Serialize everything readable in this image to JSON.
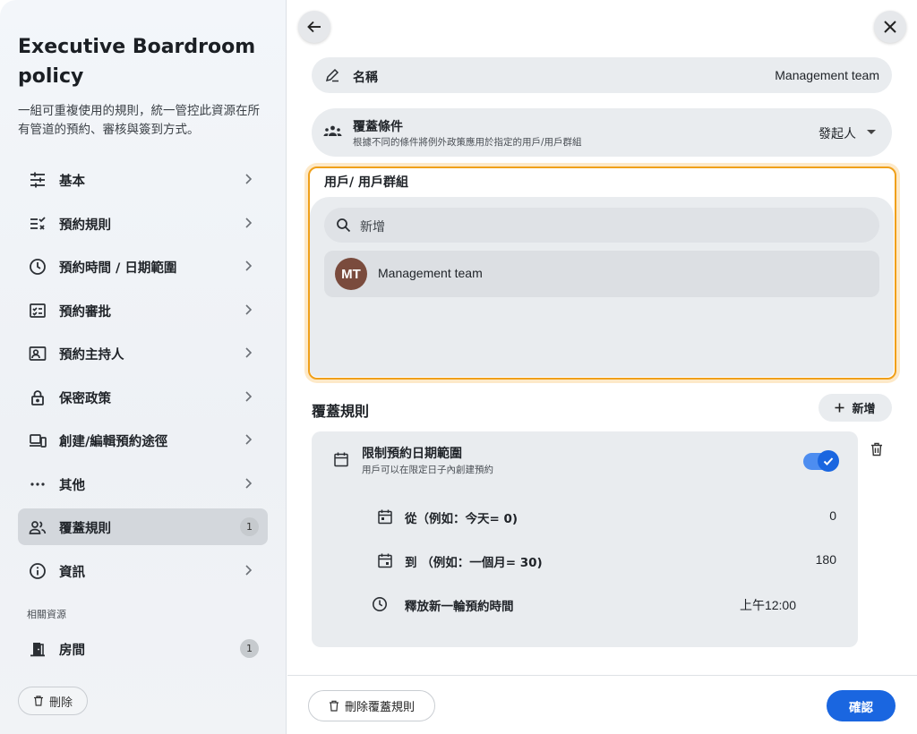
{
  "sidebar": {
    "title": "Executive Boardroom policy",
    "description": "一組可重複使用的規則，統一管控此資源在所有管道的預約、審核與簽到方式。",
    "items": [
      {
        "label": "基本",
        "icon": "tune-icon"
      },
      {
        "label": "預約規則",
        "icon": "checklist-icon"
      },
      {
        "label": "預約時間 / 日期範圍",
        "icon": "clock-icon"
      },
      {
        "label": "預約審批",
        "icon": "approval-icon"
      },
      {
        "label": "預約主持人",
        "icon": "host-icon"
      },
      {
        "label": "保密政策",
        "icon": "lock-icon"
      },
      {
        "label": "創建/編輯預約途徑",
        "icon": "devices-icon"
      },
      {
        "label": "其他",
        "icon": "more-icon"
      },
      {
        "label": "覆蓋規則",
        "icon": "people-icon",
        "badge": "1",
        "active": true
      },
      {
        "label": "資訊",
        "icon": "info-icon"
      }
    ],
    "related_label": "相關資源",
    "room": {
      "label": "房間",
      "badge": "1",
      "icon": "door-icon"
    },
    "delete_label": "刪除"
  },
  "main": {
    "name_label": "名稱",
    "name_value": "Management team",
    "cover": {
      "label": "覆蓋條件",
      "sublabel": "根據不同的條件將例外政策應用於指定的用戶/用戶群組",
      "selected": "發起人"
    },
    "users": {
      "title": "用戶/ 用戶群組",
      "search_placeholder": "新增",
      "list": [
        {
          "initials": "MT",
          "name": "Management team"
        }
      ]
    },
    "rules": {
      "title": "覆蓋規則",
      "add_label": "新增",
      "card": {
        "title": "限制預約日期範圍",
        "subtitle": "用戶可以在限定日子內創建預約",
        "enabled": true,
        "rows": [
          {
            "label": "從（例如：今天= 0)",
            "value": "0",
            "icon": "calendar-icon"
          },
          {
            "label": "到 （例如：一個月= 30)",
            "value": "180",
            "icon": "calendar-icon"
          },
          {
            "label": "釋放新一輪預約時間",
            "value": "上午12:00",
            "icon": "clock-icon"
          }
        ]
      }
    },
    "footer": {
      "delete_rule_label": "刪除覆蓋規則",
      "confirm_label": "確認"
    }
  },
  "colors": {
    "accent": "#1a66e0",
    "highlight": "#f0a01a",
    "avatar": "#7a4b3d"
  }
}
